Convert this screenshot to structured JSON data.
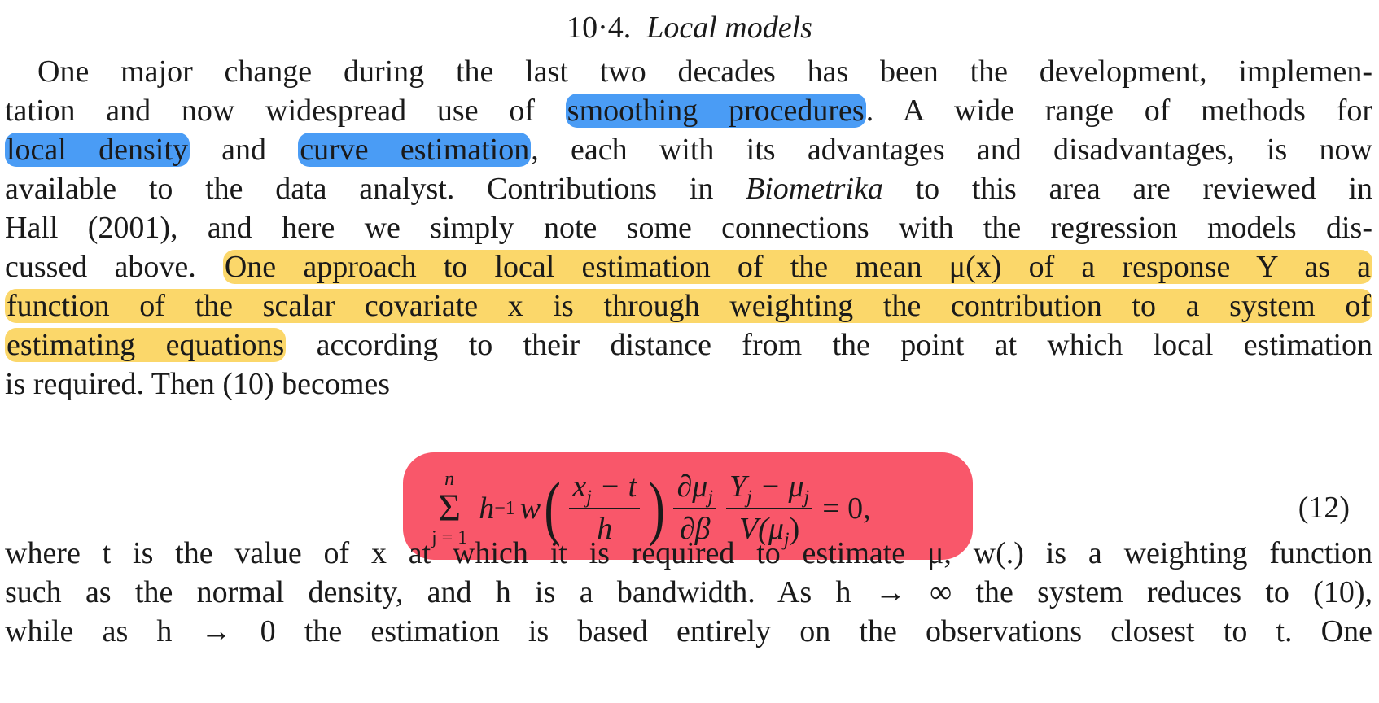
{
  "heading": {
    "section": "10·4.",
    "title": "Local models"
  },
  "lines": [
    [
      "One major change during the last two decades has been the development, implemen-"
    ],
    [
      "tation and now widespread use of ",
      "smoothing procedures",
      ". A wide range of methods for"
    ],
    [
      "local density",
      " and ",
      "curve estimation",
      ", each with its advantages and disadvantages, is now"
    ],
    [
      "available to the data analyst. Contributions in ",
      "Biometrika",
      " to this area are reviewed in"
    ],
    [
      "Hall (2001), and here we simply note some connections with the regression models dis-"
    ],
    [
      "cussed above. ",
      "One approach to local estimation of the mean μ(x) of a response Y as a"
    ],
    [
      "function of the scalar covariate x is through weighting the contribution to a system of"
    ],
    [
      "estimating equations",
      " according to their distance from the point at which local estimation"
    ],
    [
      "is required. Then (10) becomes"
    ]
  ],
  "equation": {
    "sum_upper": "n",
    "sum_symbol": "Σ",
    "sum_lower": "j = 1",
    "factor": "h",
    "factor_exp": "−1",
    "weight_fn": "w",
    "arg_num": "x",
    "arg_num_sub": "j",
    "arg_num_tail": " − t",
    "arg_den": "h",
    "deriv_num": "∂μ",
    "deriv_num_sub": "j",
    "deriv_den": "∂β",
    "resid_num": "Y",
    "resid_num_sub": "j",
    "resid_num_tail": " − μ",
    "resid_num_sub2": "j",
    "resid_den": "V(μ",
    "resid_den_sub": "j",
    "resid_den_tail": ")",
    "rhs": "= 0,",
    "number": "(12)"
  },
  "after_lines": [
    "where t is the value of x at which it is required to estimate μ, w(.) is a weighting function",
    "such as the normal density, and h is a bandwidth. As h → ∞ the system reduces to (10),",
    "while as h → 0 the estimation is based entirely on the observations closest to t. One"
  ],
  "colors": {
    "highlight_blue": "#4a9cf5",
    "highlight_yellow": "#fbd76a",
    "highlight_red": "#f9576a"
  }
}
